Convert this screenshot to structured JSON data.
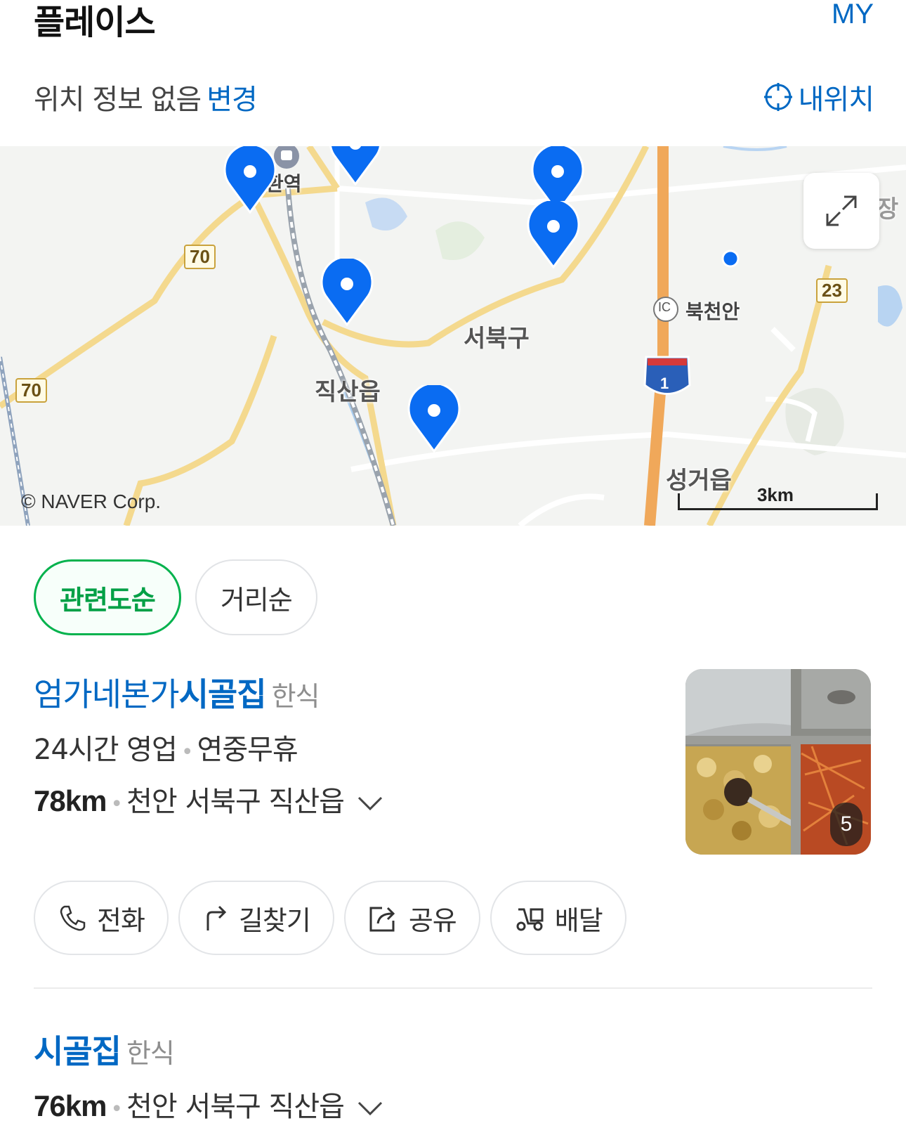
{
  "header": {
    "title": "플레이스",
    "my_label": "MY"
  },
  "location": {
    "status": "위치 정보 없음",
    "change_label": "변경",
    "my_location_label": "내위치"
  },
  "map": {
    "labels": {
      "station": "환역",
      "district": "서북구",
      "town1": "직산읍",
      "town2": "성거읍",
      "ic": "북천안",
      "ic_badge": "IC",
      "edge": "장"
    },
    "routes": {
      "r70a": "70",
      "r70b": "70",
      "r23": "23",
      "r1": "1"
    },
    "copyright": "© NAVER Corp.",
    "scale": "3km",
    "colors": {
      "pin": "#0a6cf2",
      "road": "#f7d88a",
      "highway": "#f3a85a",
      "water": "#b8d4f2"
    }
  },
  "sort": {
    "relevance": "관련도순",
    "distance": "거리순"
  },
  "places": [
    {
      "name_prefix": "엄가네본가",
      "name_bold": "시골집",
      "category": "한식",
      "hours": "24시간 영업",
      "closed": "연중무휴",
      "distance": "78km",
      "address": "천안 서북구 직산읍",
      "photo_count": "5",
      "actions": {
        "call": "전화",
        "directions": "길찾기",
        "share": "공유",
        "delivery": "배달"
      }
    },
    {
      "name_bold": "시골집",
      "category": "한식",
      "distance": "76km",
      "address": "천안 서북구 직산읍"
    }
  ]
}
